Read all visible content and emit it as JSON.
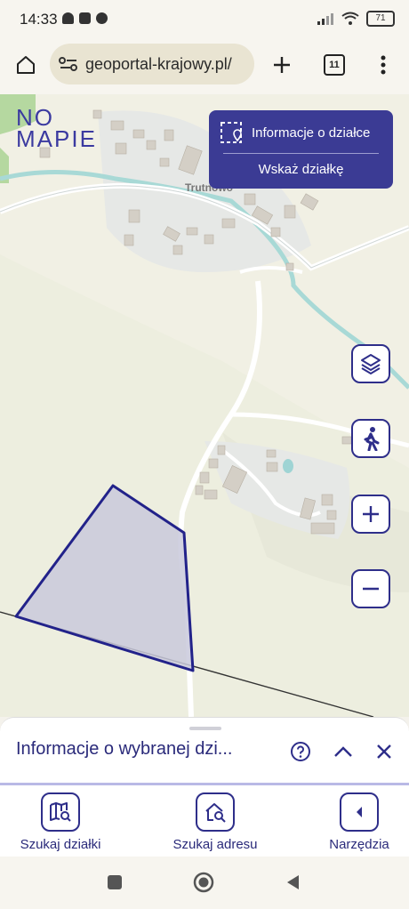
{
  "status_bar": {
    "time": "14:33",
    "battery": "71"
  },
  "browser": {
    "url": "geoportal-krajowy.pl/",
    "tab_count": "11"
  },
  "map": {
    "logo_line1": "NO",
    "logo_line2": "MAPIE",
    "place_label": "Trutnowo",
    "info_panel": {
      "title": "Informacje o działce",
      "action": "Wskaż działkę"
    }
  },
  "bottom_sheet": {
    "title": "Informacje o wybranej dzi..."
  },
  "toolbar": {
    "search_parcel": "Szukaj działki",
    "search_address": "Szukaj adresu",
    "tools": "Narzędzia"
  },
  "colors": {
    "accent": "#2e2e8a",
    "parcel_fill": "#c9c9dc",
    "water": "#9fd4d4"
  }
}
